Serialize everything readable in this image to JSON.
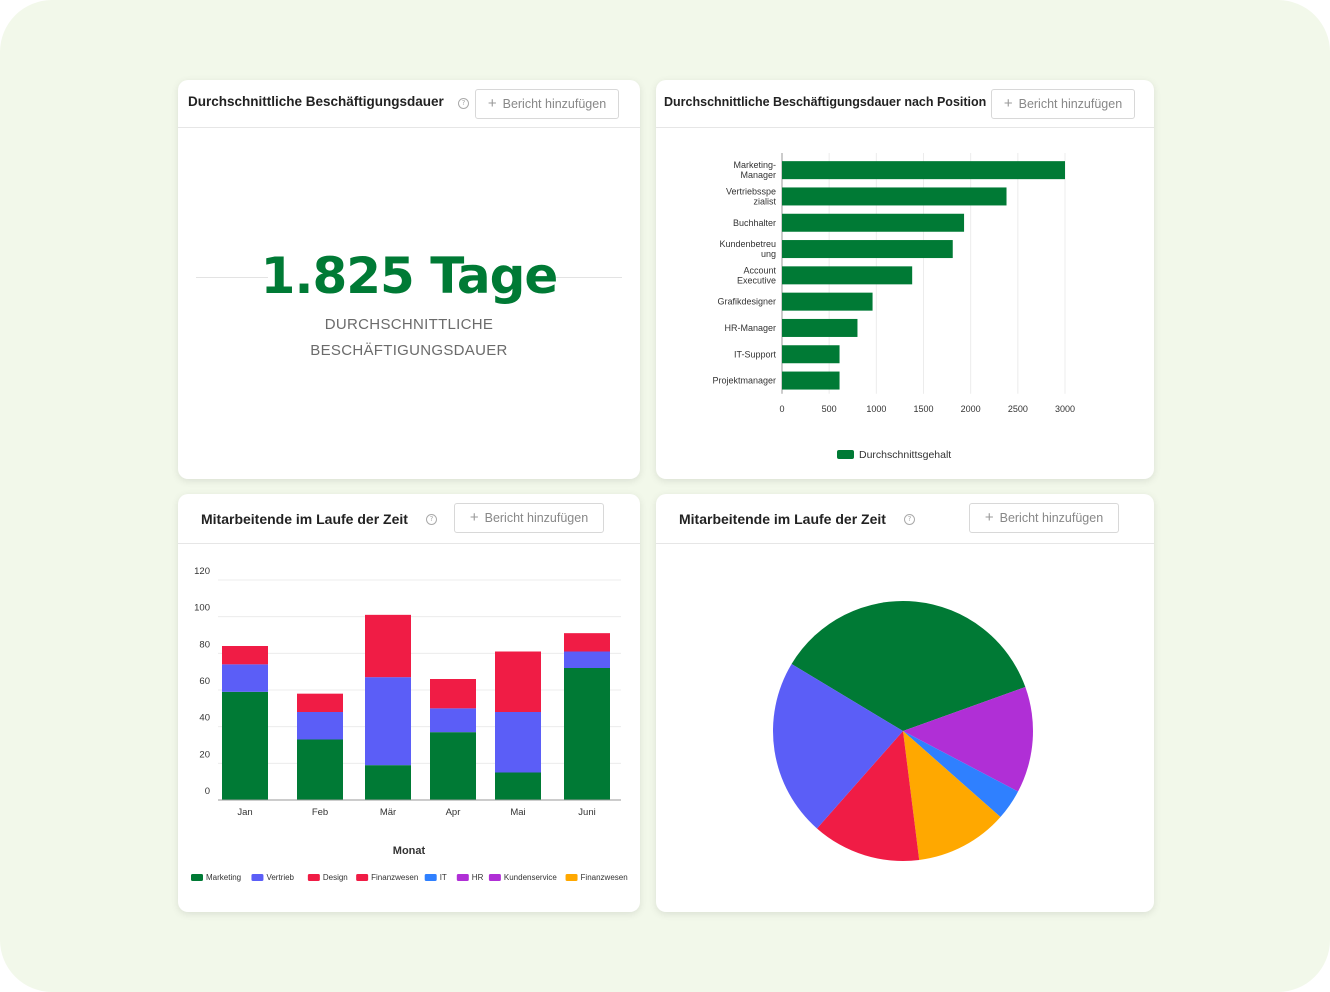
{
  "colors": {
    "primary": "#007a35",
    "canvas_bg": "#f2f8ea"
  },
  "cards": {
    "tenure": {
      "title": "Durchschnittliche Beschäftigungsdauer",
      "add_button": "Bericht hinzufügen",
      "value": "1.825 Tage",
      "caption_line1": "DURCHSCHNITTLICHE",
      "caption_line2": "BESCHÄFTIGUNGSDAUER"
    },
    "by_position": {
      "title": "Durchschnittliche Beschäftigungsdauer nach Position",
      "add_button": "Bericht hinzufügen"
    },
    "over_time": {
      "title": "Mitarbeitende im Laufe der Zeit",
      "add_button": "Bericht hinzufügen"
    },
    "pie": {
      "title": "Mitarbeitende im Laufe der Zeit",
      "add_button": "Bericht hinzufügen"
    }
  },
  "chart_data": [
    {
      "type": "bar",
      "orientation": "horizontal",
      "categories": [
        [
          "Marketing-",
          "Manager"
        ],
        [
          "Vertriebsspe",
          "zialist"
        ],
        [
          "Buchhalter"
        ],
        [
          "Kundenbetreu",
          "ung"
        ],
        [
          "Account",
          "Executive"
        ],
        [
          "Grafikdesigner"
        ],
        [
          "HR-Manager"
        ],
        [
          "IT-Support"
        ],
        [
          "Projektmanager"
        ]
      ],
      "values": [
        3000,
        2380,
        1930,
        1810,
        1380,
        960,
        800,
        610,
        610
      ],
      "series": [
        {
          "name": "Durchschnittsgehalt",
          "color": "#007a35"
        }
      ],
      "xlim": [
        0,
        3000
      ],
      "xticks": [
        0,
        500,
        1000,
        1500,
        2000,
        2500,
        3000
      ],
      "grid": true,
      "legend": "bottom"
    },
    {
      "type": "bar",
      "stacked": true,
      "categories": [
        "Jan",
        "Feb",
        "Mär",
        "Apr",
        "Mai",
        "Juni"
      ],
      "xlabel": "Monat",
      "ylim": [
        0,
        120
      ],
      "yticks": [
        0,
        20,
        40,
        60,
        80,
        100,
        120
      ],
      "series": [
        {
          "name": "Marketing",
          "color": "#007a35",
          "values": [
            59,
            33,
            19,
            37,
            15,
            72
          ]
        },
        {
          "name": "Vertrieb",
          "color": "#5b5ef7",
          "values": [
            15,
            15,
            48,
            13,
            33,
            9
          ]
        },
        {
          "name": "Design",
          "color": "#f01c45",
          "values": [
            10,
            10,
            34,
            16,
            33,
            10
          ]
        }
      ],
      "legend_entries": [
        {
          "name": "Marketing",
          "color": "#007a35"
        },
        {
          "name": "Vertrieb",
          "color": "#5b5ef7"
        },
        {
          "name": "Design",
          "color": "#f01c45"
        },
        {
          "name": "Finanzwesen",
          "color": "#f01c45"
        },
        {
          "name": "IT",
          "color": "#2f80ff"
        },
        {
          "name": "HR",
          "color": "#b02fd6"
        },
        {
          "name": "Kundenservice",
          "color": "#b02fd6"
        },
        {
          "name": "Finanzwesen",
          "color": "#ffa800"
        }
      ],
      "legend": "bottom",
      "grid": true
    },
    {
      "type": "pie",
      "slices": [
        {
          "value": 35.9,
          "color": "#007a35"
        },
        {
          "value": 13.2,
          "color": "#b02fd6"
        },
        {
          "value": 3.8,
          "color": "#2f80ff"
        },
        {
          "value": 11.5,
          "color": "#ffa800"
        },
        {
          "value": 13.5,
          "color": "#f01c45"
        },
        {
          "value": 22.1,
          "color": "#5b5ef7"
        }
      ]
    }
  ]
}
